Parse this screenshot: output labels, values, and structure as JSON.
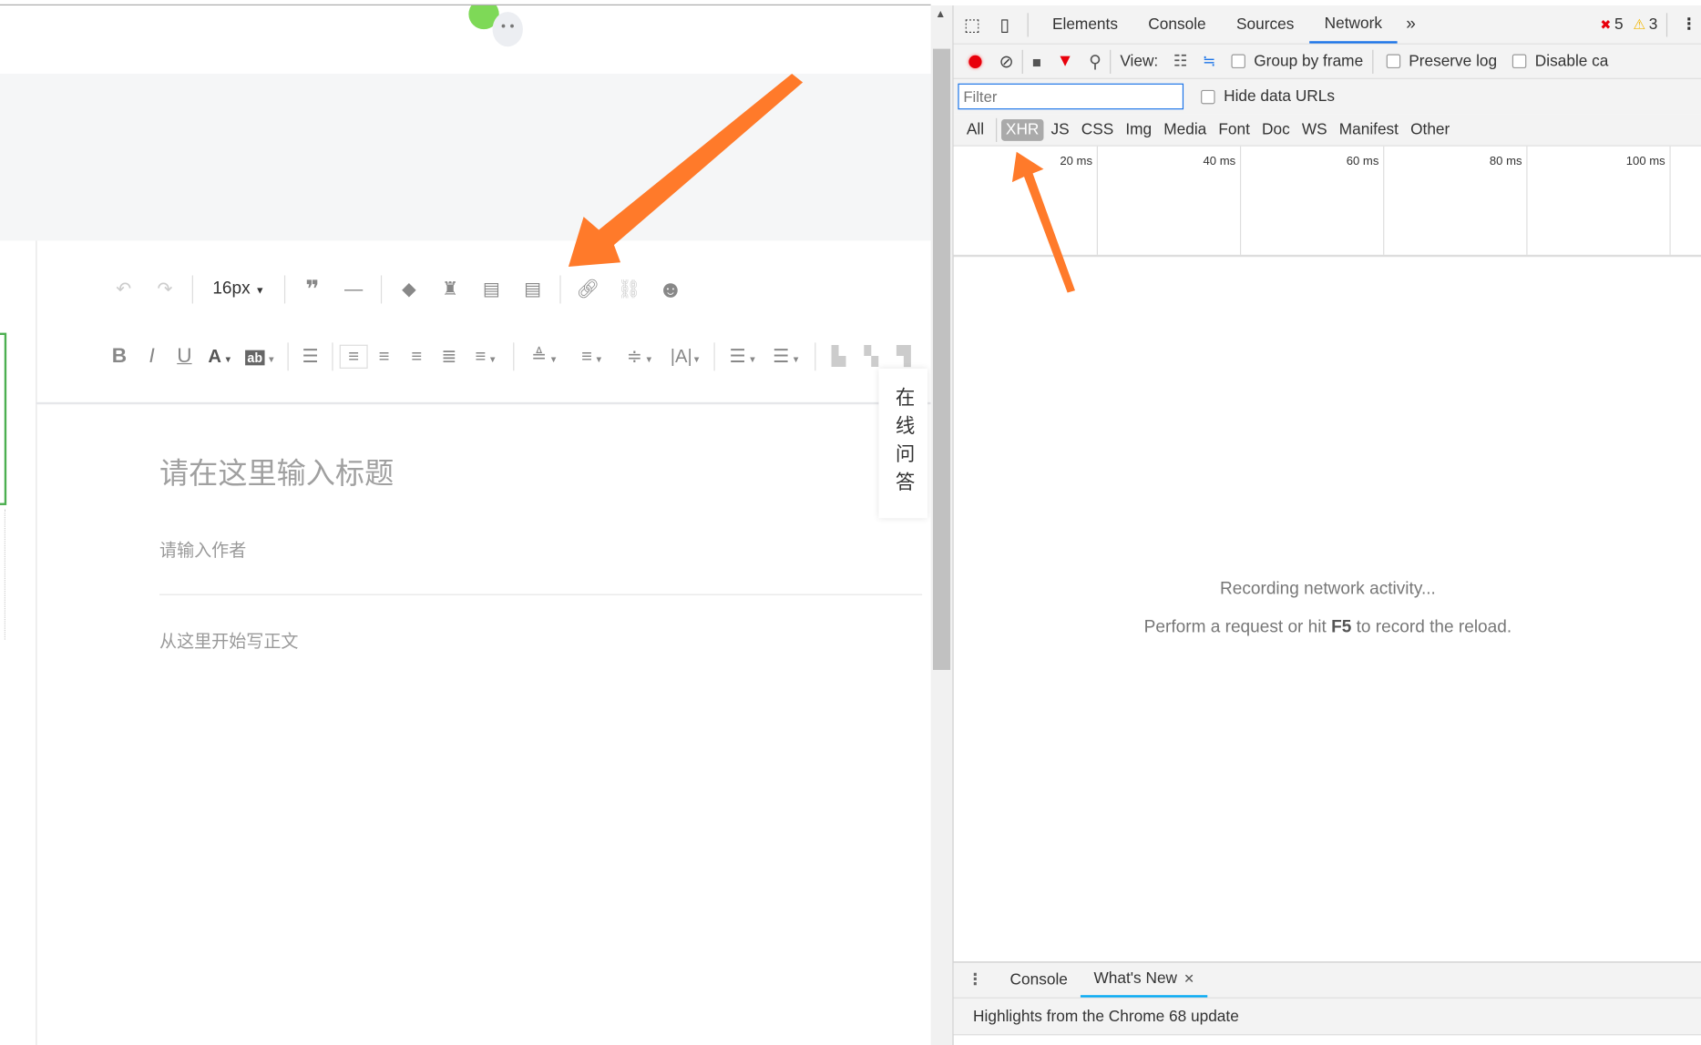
{
  "editor": {
    "font_size": "16px",
    "title_placeholder": "请在这里输入标题",
    "author_placeholder": "请输入作者",
    "body_placeholder": "从这里开始写正文",
    "qa_label": "在线问答",
    "toolbar_row1": [
      "undo-icon",
      "redo-icon",
      "quote-icon",
      "horizontal-rule-icon",
      "eraser-icon",
      "format-brush-icon",
      "insert-paragraph-icon",
      "paragraph-icon",
      "link-icon",
      "unlink-icon",
      "emoji-icon"
    ],
    "toolbar_row2": [
      "bold-icon",
      "italic-icon",
      "underline-icon",
      "font-color-icon",
      "background-color-icon",
      "indent-icon",
      "align-left-icon",
      "align-center-icon",
      "align-right-icon",
      "align-justify-icon",
      "line-spacing-icon",
      "space-before-icon",
      "space-after-icon",
      "row-spacing-icon",
      "letter-spacing-icon",
      "ordered-list-icon",
      "unordered-list-icon",
      "image-left-icon",
      "image-center-icon",
      "image-right-icon"
    ]
  },
  "devtools": {
    "tabs": [
      "Elements",
      "Console",
      "Sources",
      "Network"
    ],
    "active_tab": "Network",
    "more": "»",
    "errors": "5",
    "warnings": "3",
    "view_label": "View:",
    "group_by_frame": "Group by frame",
    "preserve_log": "Preserve log",
    "disable_cache": "Disable ca",
    "filter_placeholder": "Filter",
    "hide_data_urls": "Hide data URLs",
    "types": [
      "All",
      "XHR",
      "JS",
      "CSS",
      "Img",
      "Media",
      "Font",
      "Doc",
      "WS",
      "Manifest",
      "Other"
    ],
    "active_type": "XHR",
    "timeline_ticks": [
      "20 ms",
      "40 ms",
      "60 ms",
      "80 ms",
      "100 ms"
    ],
    "recording": "Recording network activity...",
    "hint_pre": "Perform a request or hit ",
    "hint_key": "F5",
    "hint_post": " to record the reload.",
    "drawer_tabs": [
      "Console",
      "What's New"
    ],
    "drawer_active": "What's New",
    "drawer_close": "✕",
    "drawer_content": "Highlights from the Chrome 68 update"
  },
  "colors": {
    "arrow": "#ff7a2a",
    "accent": "#1a73e8",
    "record": "#e8000b"
  }
}
